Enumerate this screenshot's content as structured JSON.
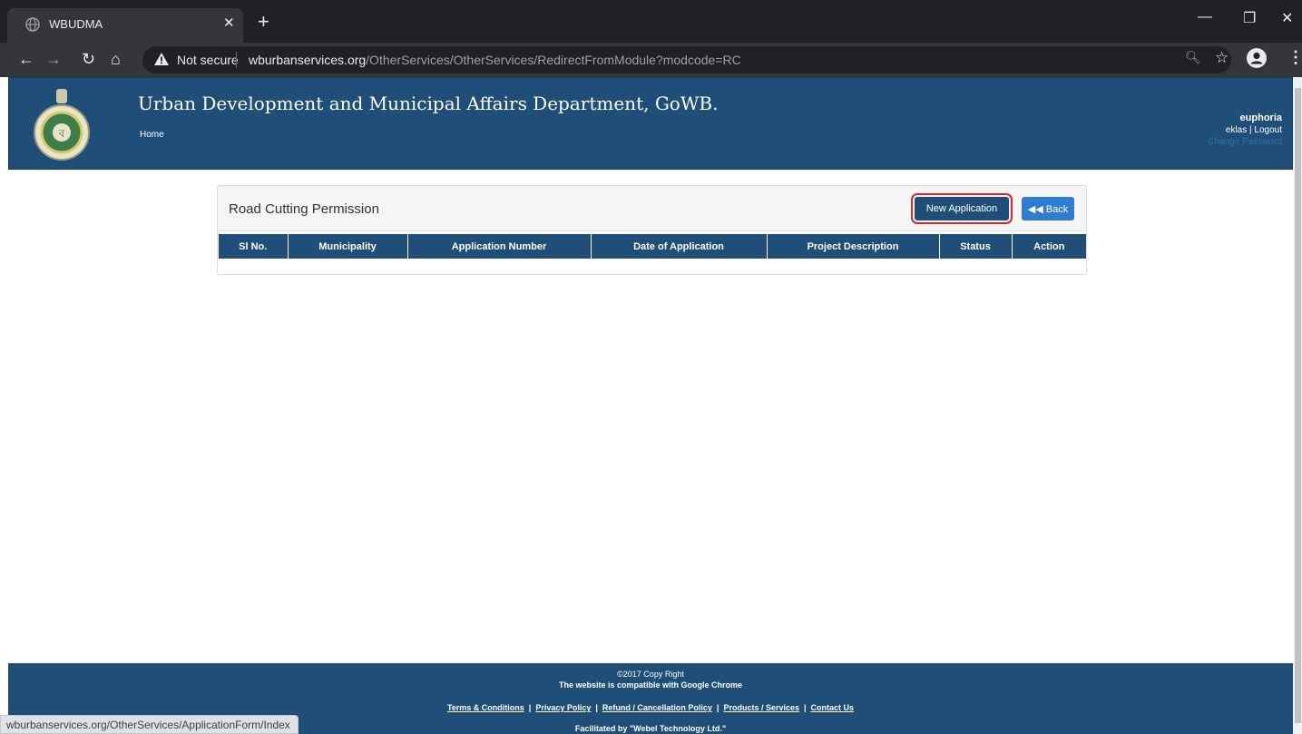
{
  "browser": {
    "tab_title": "WBUDMA",
    "not_secure": "Not secure",
    "url_domain": "wburbanservices.org",
    "url_path": "/OtherServices/OtherServices/RedirectFromModule?modcode=RC",
    "status_url": "wburbanservices.org/OtherServices/ApplicationForm/Index"
  },
  "header": {
    "title": "Urban Development and Municipal Affairs Department, GoWB.",
    "home": "Home",
    "user_name": "euphoria",
    "user_id": "eklas",
    "separator": "|",
    "logout": "Logout",
    "change_password": "Change Password"
  },
  "panel": {
    "title": "Road Cutting Permission",
    "new_application": "New Application",
    "back": "Back",
    "columns": [
      "Sl No.",
      "Municipality",
      "Application Number",
      "Date of Application",
      "Project Description",
      "Status",
      "Action"
    ]
  },
  "footer": {
    "copyright": "©2017 Copy Right",
    "compat": "The website is compatible with Google Chrome",
    "links": [
      "Terms & Conditions",
      "Privacy Policy",
      "Refund / Cancellation Policy",
      "Products / Services",
      "Contact Us"
    ],
    "facilitated": "Facilitated by \"Webel Technology Ltd.\""
  },
  "colors": {
    "brand": "#1f4e79",
    "highlight": "#d9262c",
    "back_button": "#2e7dd1"
  }
}
